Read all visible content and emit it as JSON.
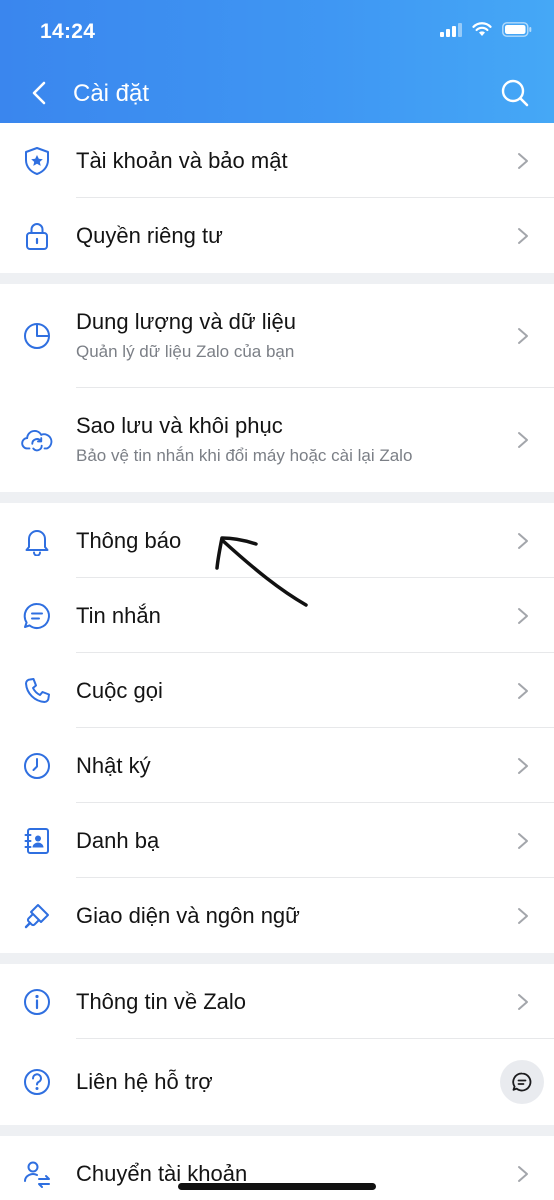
{
  "status": {
    "time": "14:24"
  },
  "nav": {
    "title": "Cài đặt"
  },
  "colors": {
    "accent": "#3b8bf0",
    "icon": "#2f6fe0",
    "chevron": "#a3a6ab"
  },
  "groups": [
    [
      {
        "icon": "shield-icon",
        "title": "Tài khoản và bảo mật"
      },
      {
        "icon": "lock-icon",
        "title": "Quyền riêng tư"
      }
    ],
    [
      {
        "icon": "pie-chart-icon",
        "title": "Dung lượng và dữ liệu",
        "subtitle": "Quản lý dữ liệu Zalo của bạn"
      },
      {
        "icon": "cloud-sync-icon",
        "title": "Sao lưu và khôi phục",
        "subtitle": "Bảo vệ tin nhắn khi đổi máy hoặc cài lại Zalo"
      }
    ],
    [
      {
        "icon": "bell-icon",
        "title": "Thông báo"
      },
      {
        "icon": "chat-icon",
        "title": "Tin nhắn"
      },
      {
        "icon": "phone-icon",
        "title": "Cuộc gọi"
      },
      {
        "icon": "clock-icon",
        "title": "Nhật ký"
      },
      {
        "icon": "contacts-icon",
        "title": "Danh bạ"
      },
      {
        "icon": "brush-icon",
        "title": "Giao diện và ngôn ngữ"
      }
    ],
    [
      {
        "icon": "info-icon",
        "title": "Thông tin về Zalo"
      },
      {
        "icon": "help-icon",
        "title": "Liên hệ hỗ trợ",
        "action_icon": "chat-bubble-icon"
      }
    ],
    [
      {
        "icon": "switch-account-icon",
        "title": "Chuyển tài khoản"
      }
    ]
  ]
}
